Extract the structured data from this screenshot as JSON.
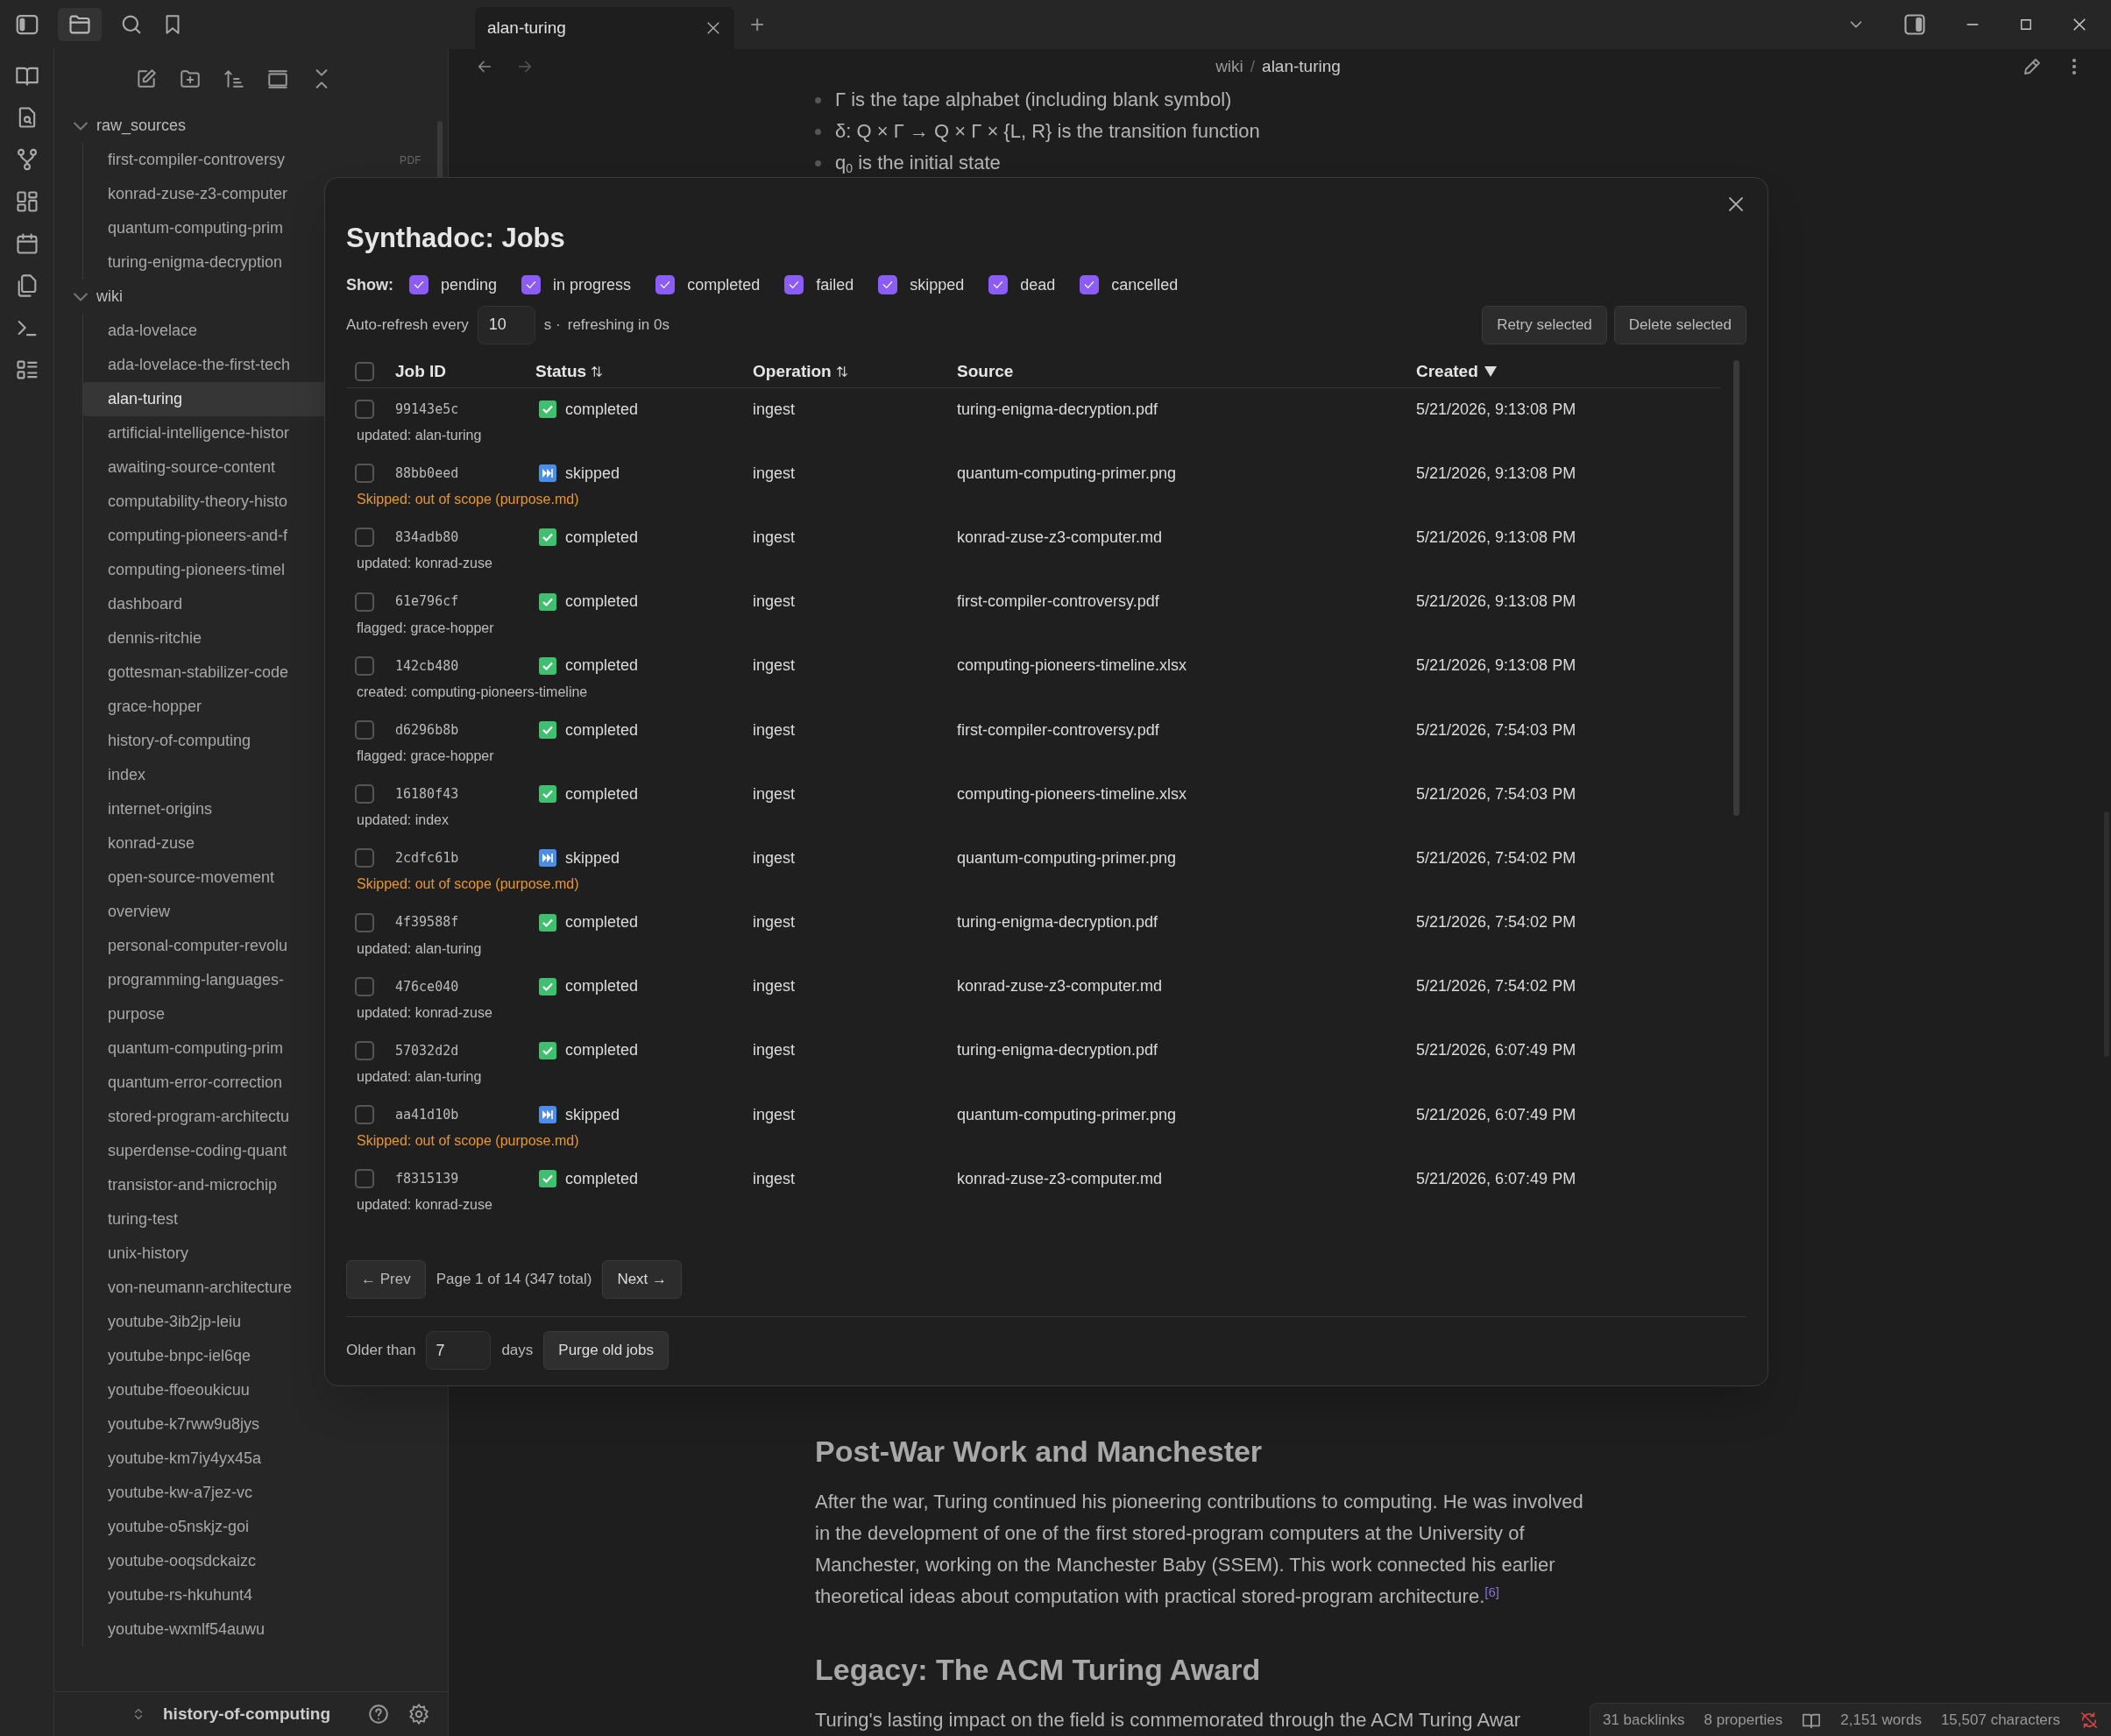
{
  "title_bar": {
    "tabs": [
      {
        "label": "alan-turing",
        "selected": true
      }
    ],
    "new_tab": "+"
  },
  "sidebar": {
    "tree": [
      {
        "label": "raw_sources",
        "expanded": true,
        "selected": false,
        "children": [
          {
            "label": "first-compiler-controversy",
            "badge": "PDF",
            "selected": false
          },
          {
            "label": "konrad-zuse-z3-computer",
            "selected": false
          },
          {
            "label": "quantum-computing-prim",
            "selected": false
          },
          {
            "label": "turing-enigma-decryption",
            "selected": false
          }
        ]
      },
      {
        "label": "wiki",
        "expanded": true,
        "selected": false,
        "children": [
          {
            "label": "ada-lovelace",
            "selected": false
          },
          {
            "label": "ada-lovelace-the-first-tech",
            "selected": false
          },
          {
            "label": "alan-turing",
            "selected": true
          },
          {
            "label": "artificial-intelligence-histor",
            "selected": false
          },
          {
            "label": "awaiting-source-content",
            "selected": false
          },
          {
            "label": "computability-theory-histo",
            "selected": false
          },
          {
            "label": "computing-pioneers-and-f",
            "selected": false
          },
          {
            "label": "computing-pioneers-timel",
            "selected": false
          },
          {
            "label": "dashboard",
            "selected": false
          },
          {
            "label": "dennis-ritchie",
            "selected": false
          },
          {
            "label": "gottesman-stabilizer-code",
            "selected": false
          },
          {
            "label": "grace-hopper",
            "selected": false
          },
          {
            "label": "history-of-computing",
            "selected": false
          },
          {
            "label": "index",
            "selected": false
          },
          {
            "label": "internet-origins",
            "selected": false
          },
          {
            "label": "konrad-zuse",
            "selected": false
          },
          {
            "label": "open-source-movement",
            "selected": false
          },
          {
            "label": "overview",
            "selected": false
          },
          {
            "label": "personal-computer-revolu",
            "selected": false
          },
          {
            "label": "programming-languages-",
            "selected": false
          },
          {
            "label": "purpose",
            "selected": false
          },
          {
            "label": "quantum-computing-prim",
            "selected": false
          },
          {
            "label": "quantum-error-correction",
            "selected": false
          },
          {
            "label": "stored-program-architectu",
            "selected": false
          },
          {
            "label": "superdense-coding-quant",
            "selected": false
          },
          {
            "label": "transistor-and-microchip",
            "selected": false
          },
          {
            "label": "turing-test",
            "selected": false
          },
          {
            "label": "unix-history",
            "selected": false
          },
          {
            "label": "von-neumann-architecture",
            "selected": false
          },
          {
            "label": "youtube-3ib2jp-leiu",
            "selected": false
          },
          {
            "label": "youtube-bnpc-iel6qe",
            "selected": false
          },
          {
            "label": "youtube-ffoeoukicuu",
            "selected": false
          },
          {
            "label": "youtube-k7rww9u8jys",
            "selected": false
          },
          {
            "label": "youtube-km7iy4yx45a",
            "selected": false
          },
          {
            "label": "youtube-kw-a7jez-vc",
            "selected": false
          },
          {
            "label": "youtube-o5nskjz-goi",
            "selected": false
          },
          {
            "label": "youtube-ooqsdckaizc",
            "selected": false
          },
          {
            "label": "youtube-rs-hkuhunt4",
            "selected": false
          },
          {
            "label": "youtube-wxmlf54auwu",
            "selected": false
          }
        ]
      }
    ],
    "vault": "history-of-computing"
  },
  "breadcrumb": [
    "wiki",
    "/",
    "alan-turing"
  ],
  "note": {
    "bullets": [
      "Γ is the tape alphabet (including blank symbol)",
      "δ: Q × Γ → Q × Γ × {L, R} is the transition function",
      "q$_{0}$ is the initial state"
    ],
    "sections": [
      {
        "heading": "Post-War Work and Manchester",
        "paragraph": "After the war, Turing continued his pioneering contributions to computing. He was involved in the development of one of the first stored-program computers at the University of Manchester, working on the Manchester Baby (SSEM). This work connected his earlier theoretical ideas about computation with practical stored-program architecture.$^{[6]}$"
      },
      {
        "heading": "Legacy: The ACM Turing Award",
        "paragraph": "Turing's lasting impact on the field is commemorated through the ACM Turing Awar"
      }
    ]
  },
  "status_bar": {
    "backlinks": "31 backlinks",
    "properties": "8 properties",
    "words": "2,151 words",
    "characters": "15,507 characters"
  },
  "modal": {
    "title": "Synthadoc: Jobs",
    "show_label": "Show:",
    "filters": [
      {
        "label": "pending",
        "checked": true
      },
      {
        "label": "in progress",
        "checked": true
      },
      {
        "label": "completed",
        "checked": true
      },
      {
        "label": "failed",
        "checked": true
      },
      {
        "label": "skipped",
        "checked": true
      },
      {
        "label": "dead",
        "checked": true
      },
      {
        "label": "cancelled",
        "checked": true
      }
    ],
    "auto_refresh": {
      "label": "Auto-refresh every",
      "value": "10",
      "unit": "s ·",
      "countdown": "refreshing in 0s"
    },
    "buttons": [
      "Retry selected",
      "Delete selected"
    ],
    "table": {
      "all_checked": false,
      "columns": [
        {
          "label": "Job ID",
          "sortable": false,
          "sorted_descending": false
        },
        {
          "label": "Status",
          "sortable": true,
          "sorted_descending": false
        },
        {
          "label": "Operation",
          "sortable": true,
          "sorted_descending": false
        },
        {
          "label": "Source",
          "sortable": false,
          "sorted_descending": false
        },
        {
          "label": "Created",
          "sortable": false,
          "sorted_descending": true
        }
      ],
      "rows": [
        {
          "checked": false,
          "id": "99143e5c",
          "kind": "completed",
          "status": "completed",
          "operation": "ingest",
          "source": "turing-enigma-decryption.pdf",
          "created": "5/21/2026, 9:13:08 PM",
          "detail": "updated: alan-turing"
        },
        {
          "checked": false,
          "id": "88bb0eed",
          "kind": "skipped",
          "status": "skipped",
          "operation": "ingest",
          "source": "quantum-computing-primer.png",
          "created": "5/21/2026, 9:13:08 PM",
          "detail": "Skipped: out of scope (purpose.md)"
        },
        {
          "checked": false,
          "id": "834adb80",
          "kind": "completed",
          "status": "completed",
          "operation": "ingest",
          "source": "konrad-zuse-z3-computer.md",
          "created": "5/21/2026, 9:13:08 PM",
          "detail": "updated: konrad-zuse"
        },
        {
          "checked": false,
          "id": "61e796cf",
          "kind": "completed",
          "status": "completed",
          "operation": "ingest",
          "source": "first-compiler-controversy.pdf",
          "created": "5/21/2026, 9:13:08 PM",
          "detail": "flagged: grace-hopper"
        },
        {
          "checked": false,
          "id": "142cb480",
          "kind": "completed",
          "status": "completed",
          "operation": "ingest",
          "source": "computing-pioneers-timeline.xlsx",
          "created": "5/21/2026, 9:13:08 PM",
          "detail": "created: computing-pioneers-timeline"
        },
        {
          "checked": false,
          "id": "d6296b8b",
          "kind": "completed",
          "status": "completed",
          "operation": "ingest",
          "source": "first-compiler-controversy.pdf",
          "created": "5/21/2026, 7:54:03 PM",
          "detail": "flagged: grace-hopper"
        },
        {
          "checked": false,
          "id": "16180f43",
          "kind": "completed",
          "status": "completed",
          "operation": "ingest",
          "source": "computing-pioneers-timeline.xlsx",
          "created": "5/21/2026, 7:54:03 PM",
          "detail": "updated: index"
        },
        {
          "checked": false,
          "id": "2cdfc61b",
          "kind": "skipped",
          "status": "skipped",
          "operation": "ingest",
          "source": "quantum-computing-primer.png",
          "created": "5/21/2026, 7:54:02 PM",
          "detail": "Skipped: out of scope (purpose.md)"
        },
        {
          "checked": false,
          "id": "4f39588f",
          "kind": "completed",
          "status": "completed",
          "operation": "ingest",
          "source": "turing-enigma-decryption.pdf",
          "created": "5/21/2026, 7:54:02 PM",
          "detail": "updated: alan-turing"
        },
        {
          "checked": false,
          "id": "476ce040",
          "kind": "completed",
          "status": "completed",
          "operation": "ingest",
          "source": "konrad-zuse-z3-computer.md",
          "created": "5/21/2026, 7:54:02 PM",
          "detail": "updated: konrad-zuse"
        },
        {
          "checked": false,
          "id": "57032d2d",
          "kind": "completed",
          "status": "completed",
          "operation": "ingest",
          "source": "turing-enigma-decryption.pdf",
          "created": "5/21/2026, 6:07:49 PM",
          "detail": "updated: alan-turing"
        },
        {
          "checked": false,
          "id": "aa41d10b",
          "kind": "skipped",
          "status": "skipped",
          "operation": "ingest",
          "source": "quantum-computing-primer.png",
          "created": "5/21/2026, 6:07:49 PM",
          "detail": "Skipped: out of scope (purpose.md)"
        },
        {
          "checked": false,
          "id": "f8315139",
          "kind": "completed",
          "status": "completed",
          "operation": "ingest",
          "source": "konrad-zuse-z3-computer.md",
          "created": "5/21/2026, 6:07:49 PM",
          "detail": "updated: konrad-zuse"
        }
      ]
    },
    "pagination": {
      "prev": "← Prev",
      "info": "Page 1 of 14 (347 total)",
      "next": "Next →"
    },
    "purge": {
      "label": "Older than",
      "value": "7",
      "unit": "days",
      "button": "Purge old jobs"
    }
  }
}
